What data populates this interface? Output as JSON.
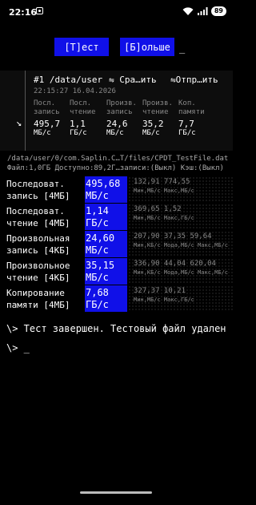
{
  "statusbar": {
    "time": "22:16",
    "battery": "89"
  },
  "buttons": {
    "test": "[Т]ест",
    "more": "[Б]ольше",
    "cursor": "_"
  },
  "result_panel": {
    "title": "#1 /data/user",
    "compare": "⇋ Сра…ить",
    "send": "⇋Отпр…ить",
    "datetime": "22:15:27 16.04.2026",
    "columns": [
      {
        "label1": "Посл.",
        "label2": "запись",
        "value": "495,7",
        "unit": "МБ/с"
      },
      {
        "label1": "Посл.",
        "label2": "чтение",
        "value": "1,1",
        "unit": "ГБ/с"
      },
      {
        "label1": "Произв.",
        "label2": "запись",
        "value": "24,6",
        "unit": "МБ/с"
      },
      {
        "label1": "Произв.",
        "label2": "чтение",
        "value": "35,2",
        "unit": "МБ/с"
      },
      {
        "label1": "Коп.",
        "label2": "памяти",
        "value": "7,7",
        "unit": "ГБ/с"
      }
    ]
  },
  "file_path": "/data/user/0/com.Saplin.C…T/files/CPDT_TestFile.dat",
  "file_info": "Файл:1,0ГБ Доступно:89,2Г…записи:(Выкл) Кэш:(Выкл)",
  "results": [
    {
      "name1": "Последоват.",
      "name2": "запись [4МБ]",
      "value": "495,68",
      "unit": "МБ/с",
      "stats1": "132,91  774,55",
      "stats2": "Мин,МБ/с Макс,МБ/с"
    },
    {
      "name1": "Последоват.",
      "name2": "чтение [4МБ]",
      "value": "1,14",
      "unit": "ГБ/с",
      "stats1": "369,65  1,52",
      "stats2": "Мин,МБ/с Макс,ГБ/с"
    },
    {
      "name1": "Произвольная",
      "name2": "запись [4КБ]",
      "value": "24,60",
      "unit": "МБ/с",
      "stats1": "207,90 37,35  59,64",
      "stats2": "Мин,КБ/с Мода,МБ/с Макс,МБ/с"
    },
    {
      "name1": "Произвольное",
      "name2": "чтение [4КБ]",
      "value": "35,15",
      "unit": "МБ/с",
      "stats1": "336,90 44,04  620,04",
      "stats2": "Мин,КБ/с Мода,МБ/с Макс,МБ/с"
    },
    {
      "name1": "Копирование",
      "name2": "памяти [4МБ]",
      "value": "7,68",
      "unit": "ГБ/с",
      "stats1": "327,37  10,21",
      "stats2": "Мин,МБ/с Макс,ГБ/с"
    }
  ],
  "terminal": {
    "line1": "\\> Тест завершен. Тестовый файл удален",
    "line2": "\\> _"
  }
}
